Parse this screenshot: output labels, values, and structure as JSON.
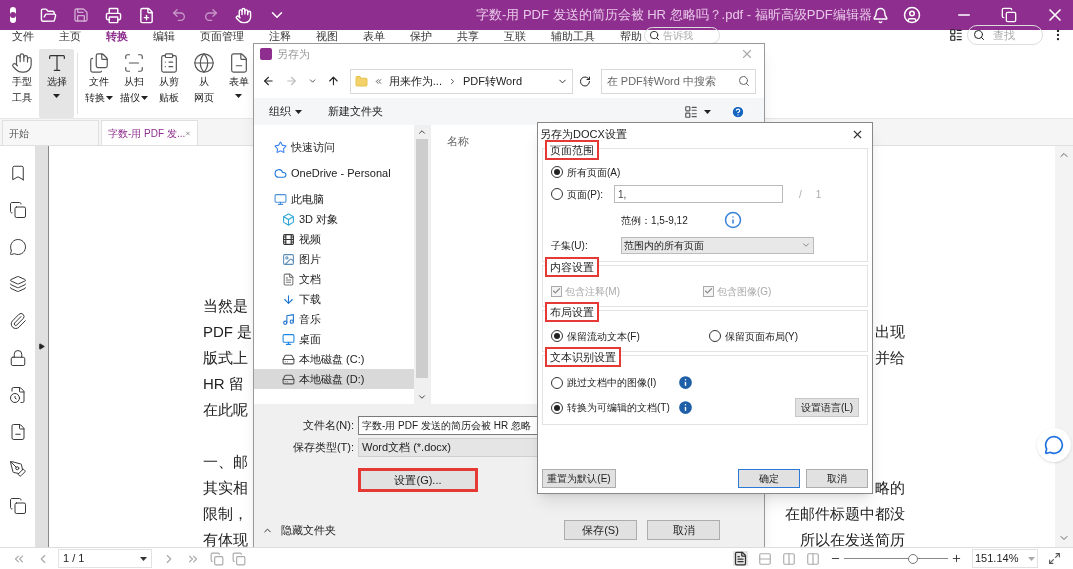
{
  "title_bar": {
    "title": "字数-用 PDF 发送的简历会被 HR 忽略吗？.pdf - 福昕高级PDF编辑器"
  },
  "menu": {
    "tabs": [
      {
        "label": "文件",
        "selected": false
      },
      {
        "label": "主页",
        "selected": false
      },
      {
        "label": "转换",
        "selected": true
      },
      {
        "label": "编辑",
        "selected": false
      },
      {
        "label": "页面管理",
        "selected": false
      },
      {
        "label": "注释",
        "selected": false
      },
      {
        "label": "视图",
        "selected": false
      },
      {
        "label": "表单",
        "selected": false
      },
      {
        "label": "保护",
        "selected": false
      },
      {
        "label": "共享",
        "selected": false
      },
      {
        "label": "互联",
        "selected": false
      },
      {
        "label": "辅助工具",
        "selected": false
      },
      {
        "label": "帮助",
        "selected": false
      }
    ],
    "tell_me": {
      "placeholder": "告诉我"
    },
    "find": {
      "placeholder": "查找"
    }
  },
  "ribbon": {
    "tools": [
      {
        "lines": [
          "手型",
          "工具"
        ],
        "selected": false,
        "dropdown": false
      },
      {
        "lines": [
          "选择"
        ],
        "selected": true,
        "dropdown": true
      },
      {
        "lines": [
          "文件",
          "转换"
        ],
        "selected": false,
        "dropdown": true
      },
      {
        "lines": [
          "从扫",
          "描仪"
        ],
        "selected": false,
        "dropdown": true
      },
      {
        "lines": [
          "从剪",
          "贴板"
        ],
        "selected": false,
        "dropdown": false
      },
      {
        "lines": [
          "从",
          "网页"
        ],
        "selected": false,
        "dropdown": false
      },
      {
        "lines": [
          "表单"
        ],
        "selected": false,
        "dropdown": true
      }
    ]
  },
  "doc_tabs": [
    {
      "label": "开始",
      "selected": false,
      "closable": false
    },
    {
      "label": "字数-用 PDF 发...",
      "selected": true,
      "closable": true
    }
  ],
  "document": {
    "paragraphs": [
      {
        "lines": [
          {
            "left": "当然是"
          },
          {
            "left": "PDF 是",
            "right": "出现"
          },
          {
            "left": "版式上",
            "right": "并给"
          },
          {
            "left": "HR 留"
          },
          {
            "left": "在此呢"
          }
        ]
      },
      {
        "lines": [
          {
            "left": "一、邮"
          },
          {
            "left": "其实相",
            "right": "略的"
          },
          {
            "left": "限制，",
            "right": "在邮件标题中都没"
          },
          {
            "left": "有体现",
            "right": "所以在发送简历"
          }
        ]
      }
    ]
  },
  "save_dialog": {
    "title": "另存为",
    "breadcrumb": [
      "用来作为...",
      "PDF转Word"
    ],
    "search": {
      "placeholder": "在 PDF转Word 中搜索"
    },
    "toolbar": {
      "organize": "组织",
      "new_folder": "新建文件夹"
    },
    "tree": [
      {
        "label": "快速访问",
        "selected": false
      },
      {
        "label": "OneDrive - Personal",
        "selected": false
      },
      {
        "label": "此电脑",
        "selected": false,
        "children": [
          {
            "label": "3D 对象",
            "selected": false
          },
          {
            "label": "视频",
            "selected": false
          },
          {
            "label": "图片",
            "selected": false
          },
          {
            "label": "文档",
            "selected": false
          },
          {
            "label": "下载",
            "selected": false
          },
          {
            "label": "音乐",
            "selected": false
          },
          {
            "label": "桌面",
            "selected": false
          },
          {
            "label": "本地磁盘 (C:)",
            "selected": false
          },
          {
            "label": "本地磁盘 (D:)",
            "selected": true
          }
        ]
      }
    ],
    "column_header": "名称",
    "file_name": {
      "label": "文件名(N):",
      "value": "字数-用 PDF 发送的简历会被 HR 忽略"
    },
    "file_type": {
      "label": "保存类型(T):",
      "value": "Word文档 (*.docx)"
    },
    "settings_button": {
      "label": "设置(G)...",
      "highlighted": true
    },
    "hide_folders": "隐藏文件夹",
    "buttons": [
      "保存(S)",
      "取消"
    ]
  },
  "docx_dialog": {
    "title": "另存为DOCX设置",
    "page_range": {
      "title": "页面范围",
      "highlighted": true,
      "all_pages": {
        "label": "所有页面(A)",
        "selected": true
      },
      "pages": {
        "label": "页面(P):",
        "selected": false,
        "value": "1,"
      },
      "separator": "/",
      "total": "1",
      "example": "范例：1,5-9,12",
      "subset": {
        "label": "子集(U):",
        "value": "范围内的所有页面"
      }
    },
    "content": {
      "title": "内容设置",
      "highlighted": true,
      "options": [
        {
          "label": "包含注释(M)",
          "checked": true,
          "disabled": true
        },
        {
          "label": "包含图像(G)",
          "checked": true,
          "disabled": true
        }
      ]
    },
    "layout": {
      "title": "布局设置",
      "highlighted": true,
      "options": [
        {
          "label": "保留流动文本(F)",
          "selected": true
        },
        {
          "label": "保留页面布局(Y)",
          "selected": false
        }
      ]
    },
    "ocr": {
      "title": "文本识别设置",
      "highlighted": true,
      "options": [
        {
          "label": "跳过文档中的图像(I)",
          "selected": false
        },
        {
          "label": "转换为可编辑的文档(T)",
          "selected": true
        }
      ],
      "language_button": "设置语言(L)"
    },
    "buttons": [
      {
        "label": "重置为默认(E)",
        "default": false
      },
      {
        "label": "确定",
        "default": true
      },
      {
        "label": "取消",
        "default": false
      }
    ]
  },
  "status_bar": {
    "page": "1 / 1",
    "zoom": "151.14%",
    "level": 0.66
  }
}
